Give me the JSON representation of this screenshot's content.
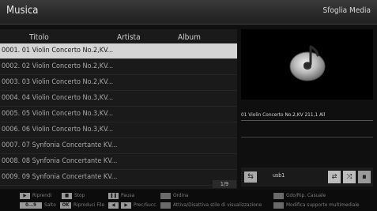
{
  "header": {
    "title": "Musica",
    "browse_label": "Sfoglia Media"
  },
  "columns": {
    "title": "Titolo",
    "artist": "Artista",
    "album": "Album"
  },
  "tracks": [
    "0001. 01 Violin Concerto No.2,KV...",
    "0002. 02 Violin Concerto No.2,KV...",
    "0003. 03 Violin Concerto No.2,KV...",
    "0004. 04 Violin Concerto No.3,KV...",
    "0005. 05 Violin Concerto No.3,KV...",
    "0006. 06 Violin Concerto No.3,KV...",
    "0007. 07 Synfonia Concertante KV...",
    "0008. 08 Synfonia Concertante KV...",
    "0009. 09 Synfonia Concertante KV..."
  ],
  "selected_index": 0,
  "pager": "1/9",
  "now_playing": "01 Violin Concerto No.2,KV 211,1 All",
  "source": {
    "icon": "usb-icon",
    "label": "usb1"
  },
  "footer": {
    "play": "Riprendi",
    "stop": "Stop",
    "pause": "Pausa",
    "sort": "Ordina",
    "shuffle": "Gdo/Rip. Casuale",
    "numbers_key": "0...9",
    "jump": "Salto",
    "ok_key": "OK",
    "play_file": "Riproduci File",
    "prev_next": "Prec/Succ.",
    "view_style": "Attiva/Disattiva stile di visualizzazione",
    "change_media": "Modifica supporto multimediale"
  },
  "colors": {
    "selection": "#d4d4d4",
    "background": "#0f0f0f",
    "panel": "#1a1a1a"
  }
}
